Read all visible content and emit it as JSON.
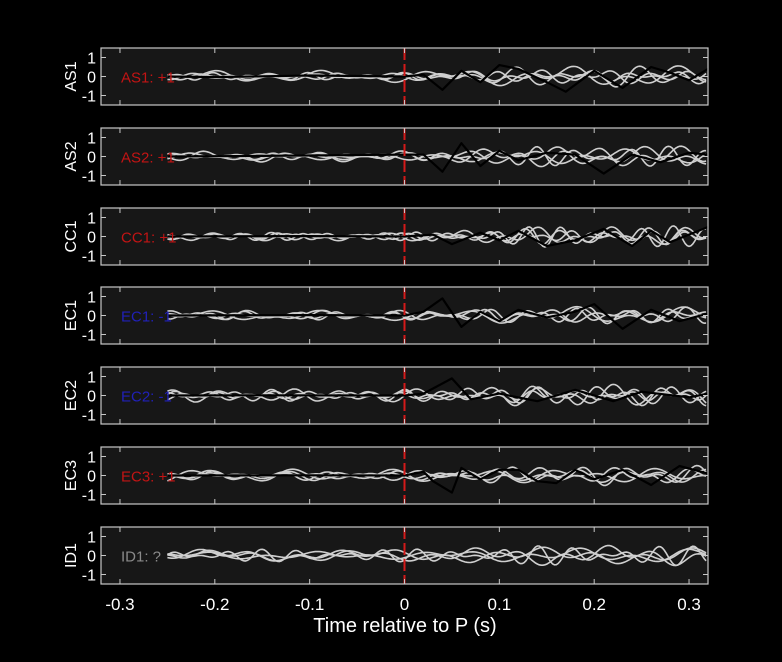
{
  "chart_data": {
    "type": "line",
    "figure_background": "#000000",
    "axes_background": "#171717",
    "xlabel": "Time relative to P (s)",
    "xlim": [
      -0.32,
      0.32
    ],
    "x_ticks": [
      -0.3,
      -0.2,
      -0.1,
      0,
      0.1,
      0.2,
      0.3
    ],
    "x_tick_labels": [
      "-0.3",
      "-0.2",
      "-0.1",
      "0",
      "0.1",
      "0.2",
      "0.3"
    ],
    "ylim": [
      -1.5,
      1.5
    ],
    "y_ticks": [
      1,
      0,
      -1
    ],
    "y_tick_labels": [
      "1",
      "0",
      "-1"
    ],
    "grid": false,
    "marker_line": {
      "x": 0,
      "color": "#d41a1a",
      "style": "dashed"
    },
    "trace_colors": {
      "traces": "#cfcfcf",
      "stack": "#000000"
    },
    "panels": [
      {
        "ylabel": "AS1",
        "label": "AS1: +1",
        "label_color": "#c21414",
        "stack": [
          [
            -0.25,
            0
          ],
          [
            -0.2,
            -0.03
          ],
          [
            -0.1,
            0.05
          ],
          [
            0,
            0
          ],
          [
            0.02,
            0.1
          ],
          [
            0.04,
            -0.7
          ],
          [
            0.06,
            0.3
          ],
          [
            0.08,
            -0.3
          ],
          [
            0.1,
            0.6
          ],
          [
            0.12,
            0.4
          ],
          [
            0.15,
            -0.3
          ],
          [
            0.17,
            -0.8
          ],
          [
            0.2,
            0.3
          ],
          [
            0.23,
            -0.6
          ],
          [
            0.26,
            0.5
          ],
          [
            0.28,
            0.2
          ],
          [
            0.3,
            -0.2
          ],
          [
            0.32,
            0.4
          ]
        ]
      },
      {
        "ylabel": "AS2",
        "label": "AS2: +1",
        "label_color": "#c21414",
        "stack": [
          [
            -0.25,
            0
          ],
          [
            -0.15,
            0.03
          ],
          [
            0,
            0.1
          ],
          [
            0.02,
            0.1
          ],
          [
            0.04,
            -0.8
          ],
          [
            0.06,
            0.7
          ],
          [
            0.08,
            -0.5
          ],
          [
            0.1,
            0.3
          ],
          [
            0.12,
            -0.2
          ],
          [
            0.15,
            0.2
          ],
          [
            0.18,
            0.1
          ],
          [
            0.21,
            -0.9
          ],
          [
            0.24,
            0.1
          ],
          [
            0.27,
            -0.3
          ],
          [
            0.3,
            0.2
          ],
          [
            0.32,
            0.1
          ]
        ]
      },
      {
        "ylabel": "CC1",
        "label": "CC1: +1",
        "label_color": "#c21414",
        "stack": [
          [
            -0.25,
            0
          ],
          [
            -0.1,
            0.02
          ],
          [
            0,
            0
          ],
          [
            0.03,
            0.1
          ],
          [
            0.05,
            -0.4
          ],
          [
            0.08,
            0.2
          ],
          [
            0.1,
            -0.2
          ],
          [
            0.12,
            0.3
          ],
          [
            0.15,
            -0.5
          ],
          [
            0.18,
            -0.2
          ],
          [
            0.21,
            0.4
          ],
          [
            0.24,
            -0.5
          ],
          [
            0.26,
            0.3
          ],
          [
            0.28,
            -0.3
          ],
          [
            0.3,
            0.1
          ],
          [
            0.32,
            0.5
          ]
        ]
      },
      {
        "ylabel": "EC1",
        "label": "EC1: -1",
        "label_color": "#2020b8",
        "stack": [
          [
            -0.25,
            0
          ],
          [
            -0.1,
            0.02
          ],
          [
            0,
            0
          ],
          [
            0.02,
            0.2
          ],
          [
            0.04,
            0.9
          ],
          [
            0.06,
            -0.6
          ],
          [
            0.08,
            0.2
          ],
          [
            0.1,
            -0.3
          ],
          [
            0.12,
            0.3
          ],
          [
            0.15,
            -0.1
          ],
          [
            0.18,
            0.2
          ],
          [
            0.2,
            0.6
          ],
          [
            0.23,
            -0.7
          ],
          [
            0.26,
            0.3
          ],
          [
            0.29,
            -0.3
          ],
          [
            0.32,
            0.1
          ]
        ]
      },
      {
        "ylabel": "EC2",
        "label": "EC2: -1",
        "label_color": "#2020b8",
        "stack": [
          [
            -0.25,
            0
          ],
          [
            -0.15,
            0.01
          ],
          [
            0,
            0
          ],
          [
            0.02,
            0.1
          ],
          [
            0.05,
            0.9
          ],
          [
            0.07,
            -0.2
          ],
          [
            0.1,
            0.1
          ],
          [
            0.14,
            -0.3
          ],
          [
            0.18,
            0.3
          ],
          [
            0.22,
            -0.3
          ],
          [
            0.25,
            0.2
          ],
          [
            0.3,
            -0.1
          ],
          [
            0.32,
            0.1
          ]
        ]
      },
      {
        "ylabel": "EC3",
        "label": "EC3: +1",
        "label_color": "#c21414",
        "stack": [
          [
            -0.25,
            0
          ],
          [
            -0.1,
            0.01
          ],
          [
            0,
            0
          ],
          [
            0.02,
            0.2
          ],
          [
            0.03,
            -0.3
          ],
          [
            0.05,
            -0.9
          ],
          [
            0.06,
            0.4
          ],
          [
            0.08,
            -0.2
          ],
          [
            0.1,
            0.3
          ],
          [
            0.12,
            0.3
          ],
          [
            0.14,
            -0.3
          ],
          [
            0.16,
            -0.4
          ],
          [
            0.18,
            0.3
          ],
          [
            0.2,
            -0.2
          ],
          [
            0.23,
            0.3
          ],
          [
            0.26,
            -0.5
          ],
          [
            0.29,
            0.5
          ],
          [
            0.32,
            0.1
          ]
        ]
      },
      {
        "ylabel": "ID1",
        "label": "ID1: ?",
        "label_color": "#8a8a8a",
        "stack": []
      }
    ]
  }
}
